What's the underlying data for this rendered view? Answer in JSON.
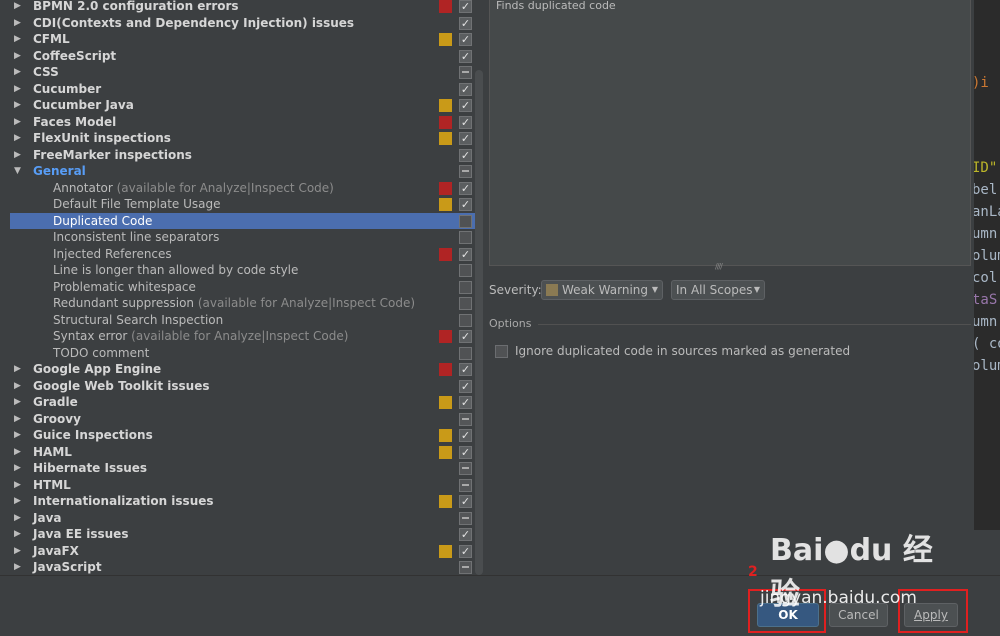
{
  "tree": [
    {
      "label": "BPMN 2.0 configuration errors",
      "kind": "group",
      "sev": "red",
      "check": "checked"
    },
    {
      "label": "CDI(Contexts and Dependency Injection) issues",
      "kind": "group",
      "sev": "",
      "check": "checked"
    },
    {
      "label": "CFML",
      "kind": "group",
      "sev": "yellow",
      "check": "checked"
    },
    {
      "label": "CoffeeScript",
      "kind": "group",
      "sev": "",
      "check": "checked"
    },
    {
      "label": "CSS",
      "kind": "group",
      "sev": "",
      "check": "partial"
    },
    {
      "label": "Cucumber",
      "kind": "group",
      "sev": "",
      "check": "checked"
    },
    {
      "label": "Cucumber Java",
      "kind": "group",
      "sev": "yellow",
      "check": "checked"
    },
    {
      "label": "Faces Model",
      "kind": "group",
      "sev": "red",
      "check": "checked"
    },
    {
      "label": "FlexUnit inspections",
      "kind": "group",
      "sev": "yellow",
      "check": "checked"
    },
    {
      "label": "FreeMarker inspections",
      "kind": "group",
      "sev": "",
      "check": "checked"
    },
    {
      "label": "General",
      "kind": "group",
      "expanded": true,
      "sev": "",
      "check": "partial"
    },
    {
      "label": "Annotator",
      "note": " (available for Analyze|Inspect Code)",
      "kind": "child",
      "sev": "red",
      "check": "checked"
    },
    {
      "label": "Default File Template Usage",
      "kind": "child",
      "sev": "yellow",
      "check": "checked"
    },
    {
      "label": "Duplicated Code",
      "kind": "child",
      "selected": true,
      "sev": "",
      "check": "off"
    },
    {
      "label": "Inconsistent line separators",
      "kind": "child",
      "sev": "",
      "check": "off"
    },
    {
      "label": "Injected References",
      "kind": "child",
      "sev": "red",
      "check": "checked"
    },
    {
      "label": "Line is longer than allowed by code style",
      "kind": "child",
      "sev": "",
      "check": "off"
    },
    {
      "label": "Problematic whitespace",
      "kind": "child",
      "sev": "",
      "check": "off"
    },
    {
      "label": "Redundant suppression",
      "note": " (available for Analyze|Inspect Code)",
      "kind": "child",
      "sev": "",
      "check": "off"
    },
    {
      "label": "Structural Search Inspection",
      "kind": "child",
      "sev": "",
      "check": "off"
    },
    {
      "label": "Syntax error",
      "note": " (available for Analyze|Inspect Code)",
      "kind": "child",
      "sev": "red",
      "check": "checked"
    },
    {
      "label": "TODO comment",
      "kind": "child",
      "sev": "",
      "check": "off"
    },
    {
      "label": "Google App Engine",
      "kind": "group",
      "sev": "red",
      "check": "checked"
    },
    {
      "label": "Google Web Toolkit issues",
      "kind": "group",
      "sev": "",
      "check": "checked"
    },
    {
      "label": "Gradle",
      "kind": "group",
      "sev": "yellow",
      "check": "checked"
    },
    {
      "label": "Groovy",
      "kind": "group",
      "sev": "",
      "check": "partial"
    },
    {
      "label": "Guice Inspections",
      "kind": "group",
      "sev": "yellow",
      "check": "checked"
    },
    {
      "label": "HAML",
      "kind": "group",
      "sev": "yellow",
      "check": "checked"
    },
    {
      "label": "Hibernate Issues",
      "kind": "group",
      "sev": "",
      "check": "partial"
    },
    {
      "label": "HTML",
      "kind": "group",
      "sev": "",
      "check": "partial"
    },
    {
      "label": "Internationalization issues",
      "kind": "group",
      "sev": "yellow",
      "check": "checked"
    },
    {
      "label": "Java",
      "kind": "group",
      "sev": "",
      "check": "partial"
    },
    {
      "label": "Java EE issues",
      "kind": "group",
      "sev": "",
      "check": "checked"
    },
    {
      "label": "JavaFX",
      "kind": "group",
      "sev": "yellow",
      "check": "checked"
    },
    {
      "label": "JavaScript",
      "kind": "group",
      "sev": "",
      "check": "partial"
    }
  ],
  "description": {
    "text": "Finds duplicated code"
  },
  "severity": {
    "label": "Severity:",
    "value": "Weak Warning",
    "scope": "In All Scopes"
  },
  "options": {
    "title": "Options",
    "ignore_label": "Ignore duplicated code in sources marked as generated"
  },
  "buttons": {
    "ok": "OK",
    "cancel": "Cancel",
    "apply": "Apply"
  },
  "annotation": {
    "number": "2"
  },
  "editor_fragments": [
    ")i",
    "ID\"",
    "bel:",
    "anLa",
    "umn",
    "olum",
    "col",
    "taS",
    "umn",
    "( co",
    "olum"
  ],
  "watermark": {
    "main": "Bai●du 经验",
    "url": "jingyan.baidu.com"
  },
  "colors": {
    "selected_row": "#4b6eaf",
    "expanded_label": "#589df6",
    "severity_error": "#b02424",
    "severity_warning": "#c99a18",
    "annotation": "#e02020"
  }
}
